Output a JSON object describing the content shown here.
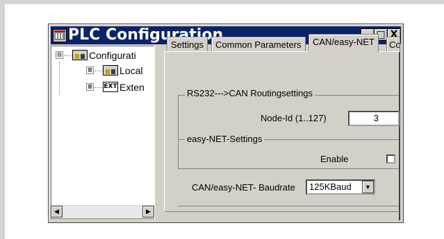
{
  "window": {
    "title": "PLC Configuration",
    "controls": {
      "minimize": "_",
      "maximize": "□",
      "close": "X"
    }
  },
  "tree": {
    "items": [
      {
        "label": "Configurati",
        "expander": "⊟",
        "icon": "module-icon"
      },
      {
        "label": "Local",
        "expander": "⊞",
        "icon": "module-icon"
      },
      {
        "label": "Exten",
        "expander": "⊞",
        "icon": "EXT"
      }
    ]
  },
  "tabs": [
    "Settings",
    "Common Parameters",
    "CAN/easy-NET",
    "Co"
  ],
  "active_tab": "CAN/easy-NET",
  "routing": {
    "caption": "RS232--->CAN Routingsettings",
    "node_id_label": "Node-Id (1..127)",
    "node_id_value": "3"
  },
  "easynet": {
    "caption": "easy-NET-Settings",
    "enable_label": "Enable",
    "enable_checked": false
  },
  "baudrate": {
    "label": "CAN/easy-NET- Baudrate",
    "value": "125KBaud"
  }
}
